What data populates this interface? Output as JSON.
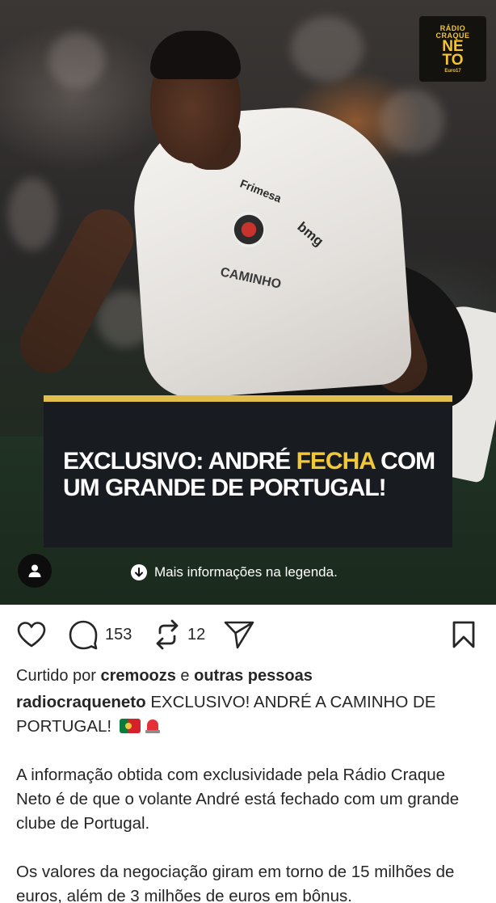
{
  "post": {
    "image": {
      "logo": {
        "line1": "RÁDIO",
        "line2": "CRAQUE",
        "line3": "NE",
        "line4": "TO",
        "line5": "Euro17"
      },
      "headline_part1": "EXCLUSIVO: ANDRÉ ",
      "headline_highlight": "FECHA",
      "headline_part2": " COM UM GRANDE DE PORTUGAL!",
      "more_info": "Mais informações na legenda.",
      "accent_color": "#f1c83a",
      "panel_color": "#181b20"
    },
    "actions": {
      "comments_count": "153",
      "reposts_count": "12"
    },
    "liked_by": {
      "prefix": "Curtido por ",
      "user": "cremoozs",
      "middle": " e ",
      "others": "outras pessoas"
    },
    "caption": {
      "username": "radiocraqueneto",
      "headline": " EXCLUSIVO! ANDRÉ A CAMINHO DE PORTUGAL!",
      "paragraph1": "A informação obtida com exclusividade pela Rádio Craque Neto é de que o volante André está fechado com um grande clube de Portugal.",
      "paragraph2": "Os valores da negociação giram em torno de 15 milhões de euros, além de 3 milhões de euros em bônus."
    }
  }
}
